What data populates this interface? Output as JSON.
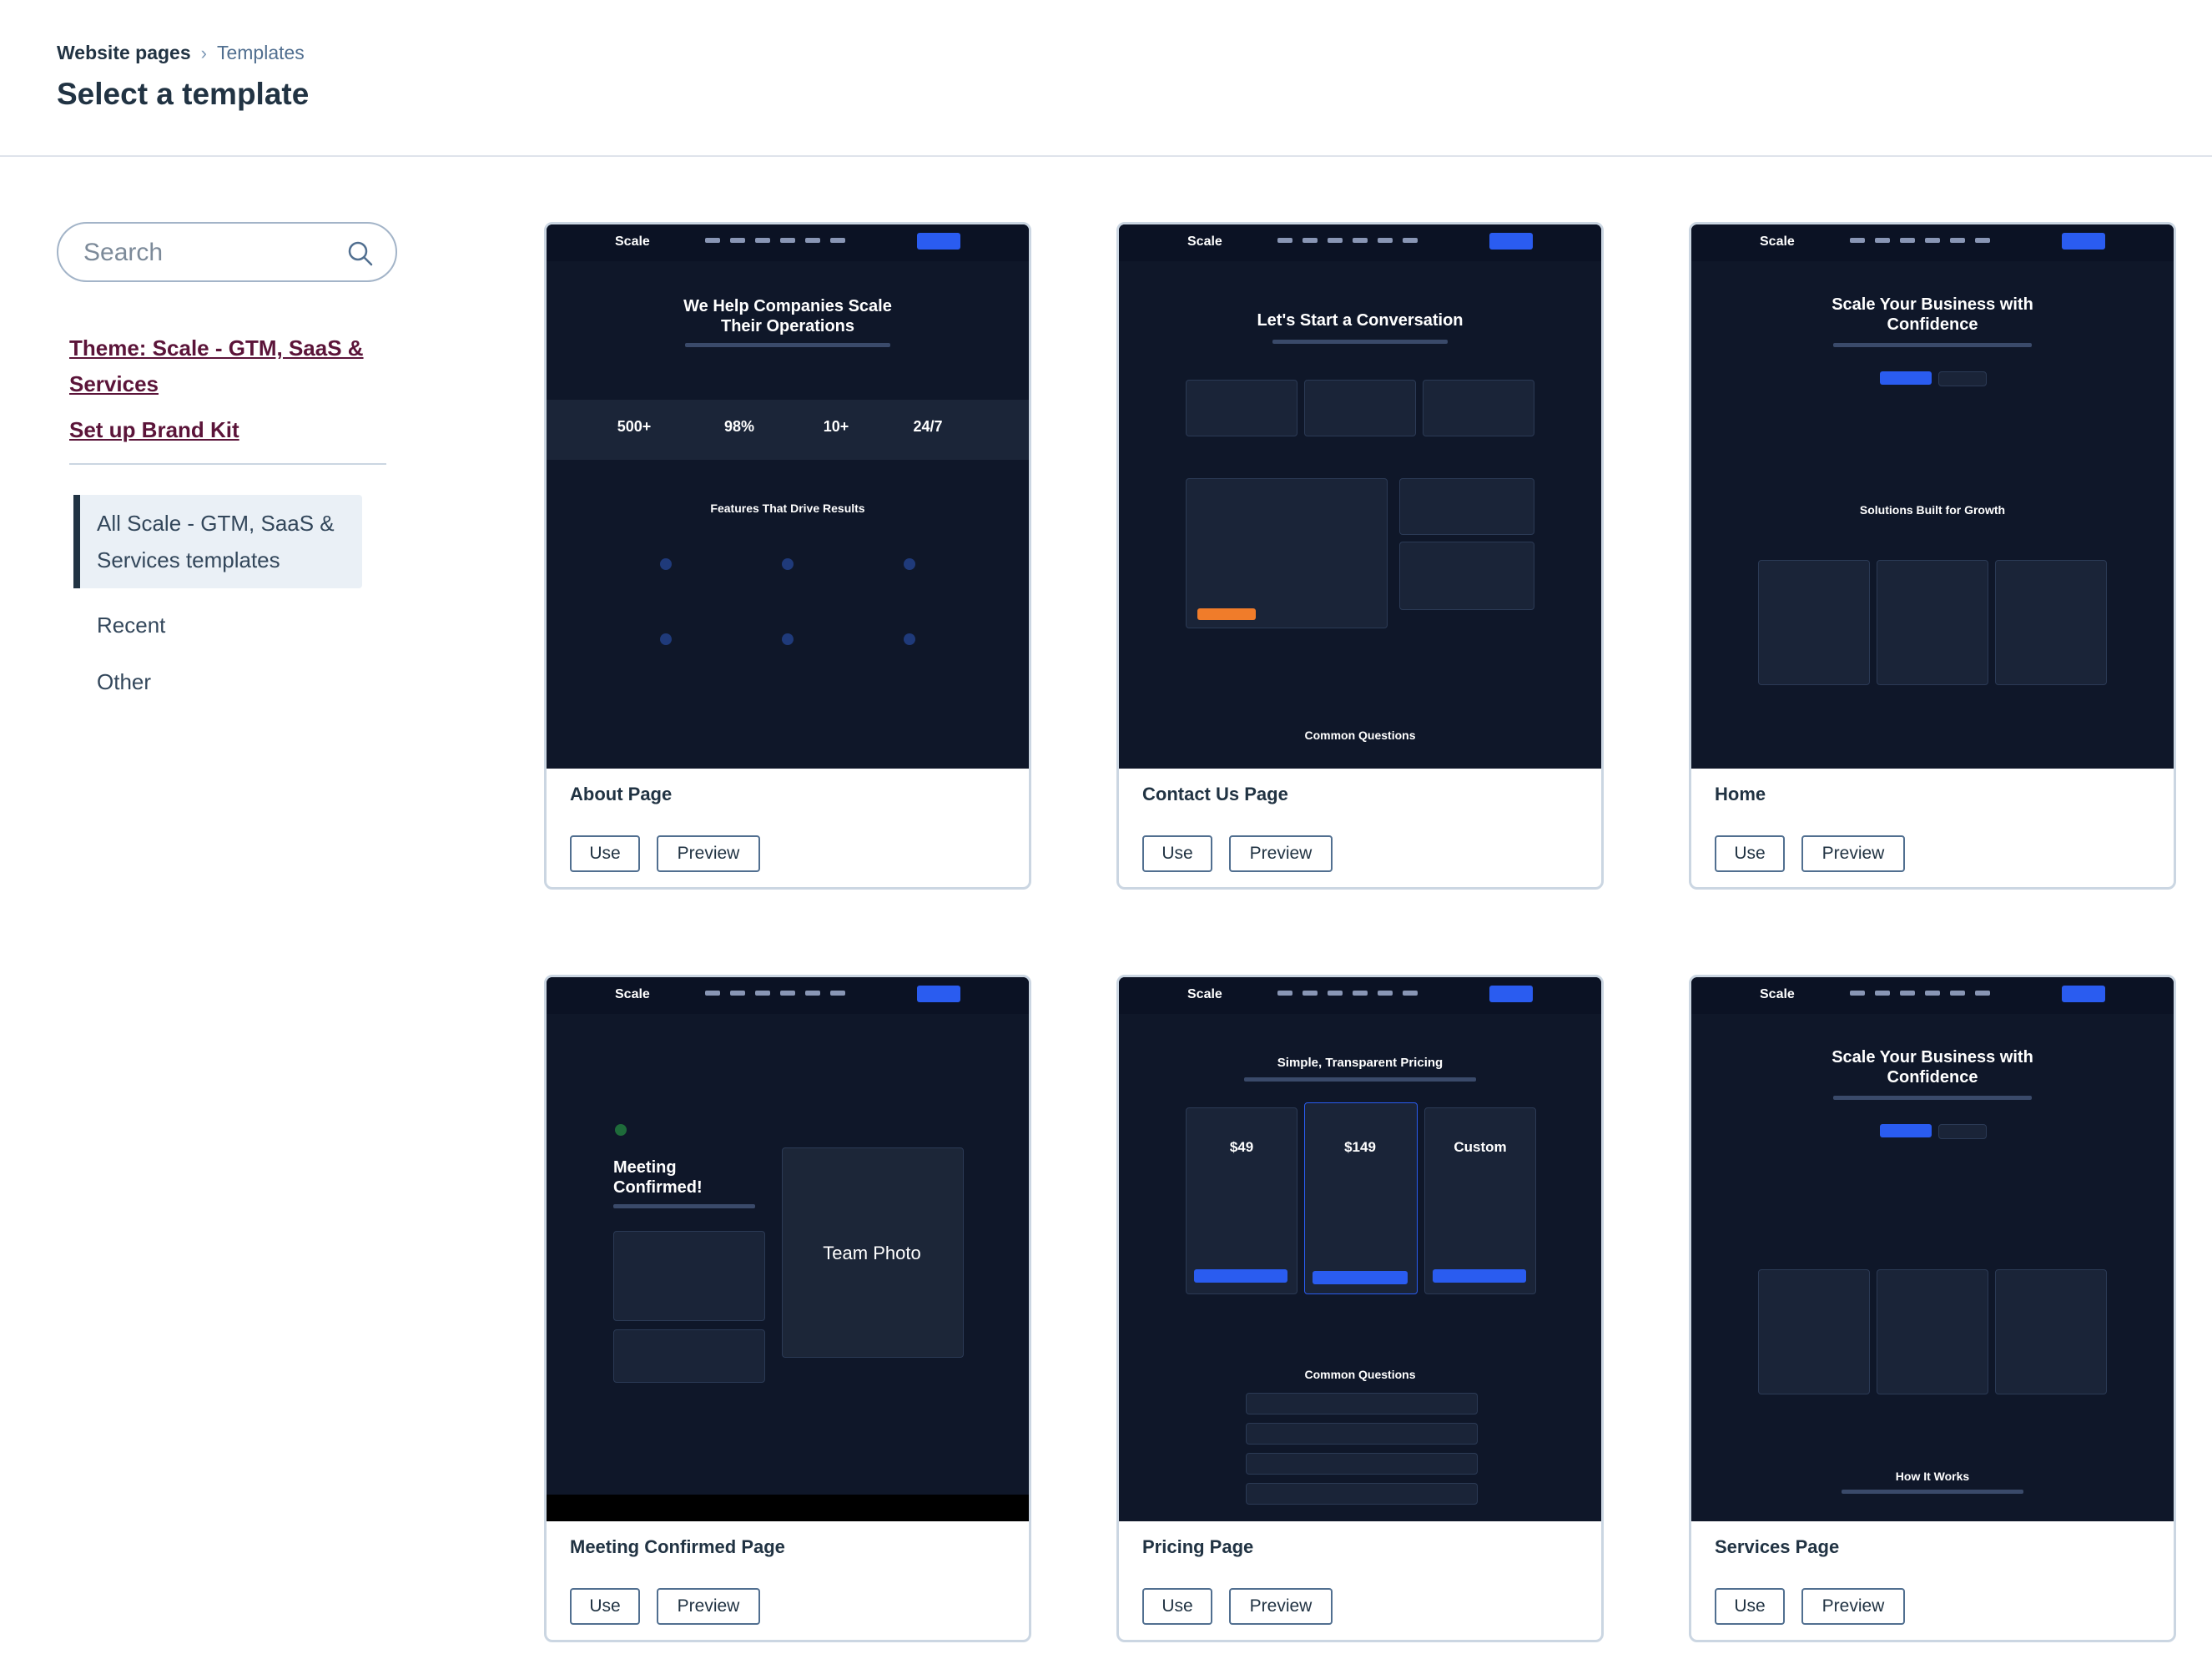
{
  "header": {
    "breadcrumb_root": "Website pages",
    "breadcrumb_current": "Templates",
    "title": "Select a template"
  },
  "sidebar": {
    "search_placeholder": "Search",
    "theme_link": "Theme: Scale - GTM, SaaS & Services",
    "brand_kit_link": "Set up Brand Kit",
    "nav": [
      {
        "label": "All Scale - GTM, SaaS & Services templates",
        "active": true
      },
      {
        "label": "Recent",
        "active": false
      },
      {
        "label": "Other",
        "active": false
      }
    ]
  },
  "templates": [
    {
      "name": "About Page",
      "use": "Use",
      "preview": "Preview",
      "thumb_heading": "We Help Companies Scale Their Operations",
      "thumb_sub": "Features That Drive Results",
      "stats": [
        "500+",
        "98%",
        "10+",
        "24/7"
      ]
    },
    {
      "name": "Contact Us Page",
      "use": "Use",
      "preview": "Preview",
      "thumb_heading": "Let's Start a Conversation",
      "thumb_sub": "Common Questions"
    },
    {
      "name": "Home",
      "use": "Use",
      "preview": "Preview",
      "thumb_heading": "Scale Your Business with Confidence",
      "thumb_sub": "Solutions Built for Growth"
    },
    {
      "name": "Meeting Confirmed Page",
      "use": "Use",
      "preview": "Preview",
      "thumb_heading": "Meeting Confirmed!",
      "thumb_sub": "Team Photo"
    },
    {
      "name": "Pricing Page",
      "use": "Use",
      "preview": "Preview",
      "thumb_heading": "Simple, Transparent Pricing",
      "thumb_sub": "Common Questions",
      "prices": [
        "$49",
        "$149",
        "Custom"
      ]
    },
    {
      "name": "Services Page",
      "use": "Use",
      "preview": "Preview",
      "thumb_heading": "Scale Your Business with Confidence",
      "thumb_sub": "How It Works"
    }
  ],
  "thumb_logo": "Scale",
  "colors": {
    "accent": "#5b1439",
    "thumb_bg": "#0f1729",
    "thumb_button": "#2a5cf0"
  },
  "icons": {
    "search": "search-icon",
    "breadcrumb_separator": "chevron-right-icon"
  }
}
